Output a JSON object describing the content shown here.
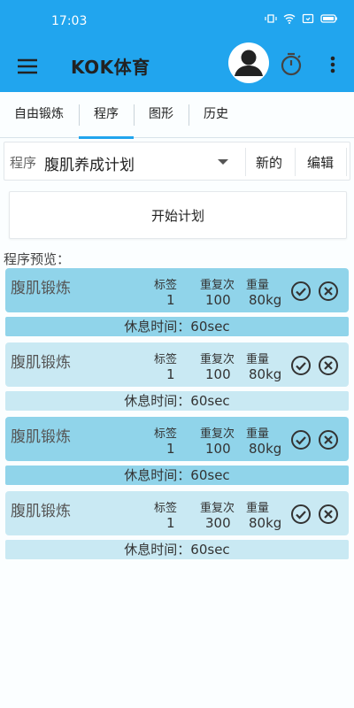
{
  "status": {
    "time": "17:03"
  },
  "appbar": {
    "title": "KOK体育"
  },
  "tabs": [
    "自由锻炼",
    "程序",
    "图形",
    "历史"
  ],
  "program": {
    "label": "程序",
    "selected": "腹肌养成计划",
    "new_label": "新的",
    "edit_label": "编辑"
  },
  "start_label": "开始计划",
  "preview_label": "程序预览：",
  "column_headers": {
    "tag": "标签",
    "reps": "重复次",
    "weight": "重量"
  },
  "exercises": [
    {
      "name": "腹肌锻炼",
      "tag": "1",
      "reps": "100",
      "weight": "80kg",
      "rest": "休息时间：60sec"
    },
    {
      "name": "腹肌锻炼",
      "tag": "1",
      "reps": "100",
      "weight": "80kg",
      "rest": "休息时间：60sec"
    },
    {
      "name": "腹肌锻炼",
      "tag": "1",
      "reps": "100",
      "weight": "80kg",
      "rest": "休息时间：60sec"
    },
    {
      "name": "腹肌锻炼",
      "tag": "1",
      "reps": "300",
      "weight": "80kg",
      "rest": "休息时间：60sec"
    }
  ],
  "colors": {
    "primary": "#21a5ee",
    "card_dark": "#90d4ea",
    "card_light": "#c9e9f3"
  }
}
